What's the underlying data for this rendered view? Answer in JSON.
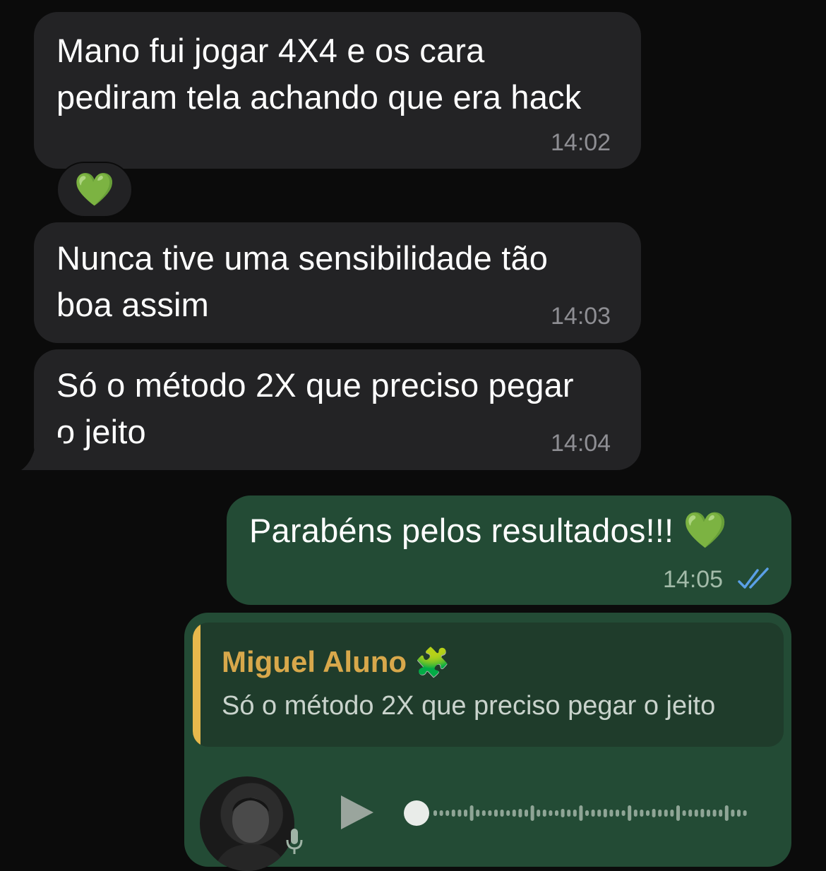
{
  "messages": [
    {
      "text_line1": "Mano fui jogar 4X4 e os cara",
      "text_line2": "pediram tela achando que era hack",
      "time": "14:02",
      "reaction": "💚"
    },
    {
      "text_line1": "Nunca tive uma sensibilidade tão",
      "text_line2": "boa assim",
      "time": "14:03"
    },
    {
      "text_line1": "Só o método 2X que preciso pegar",
      "text_line2": "o jeito",
      "time": "14:04"
    }
  ],
  "outgoing": {
    "text": "Parabéns pelos resultados!!!",
    "emoji": "💚",
    "time": "14:05",
    "status_icon": "double-check-read-icon"
  },
  "reply": {
    "quote_author": "Miguel Aluno",
    "quote_author_emoji": "🧩",
    "quote_text": "Só o método 2X que preciso pegar o jeito",
    "voice_note": {
      "progress": 0.0
    }
  },
  "colors": {
    "incoming_bubble": "#232325",
    "outgoing_bubble": "#234b35",
    "quote_accent": "#e7b94c",
    "read_ticks": "#5aa0e6"
  }
}
